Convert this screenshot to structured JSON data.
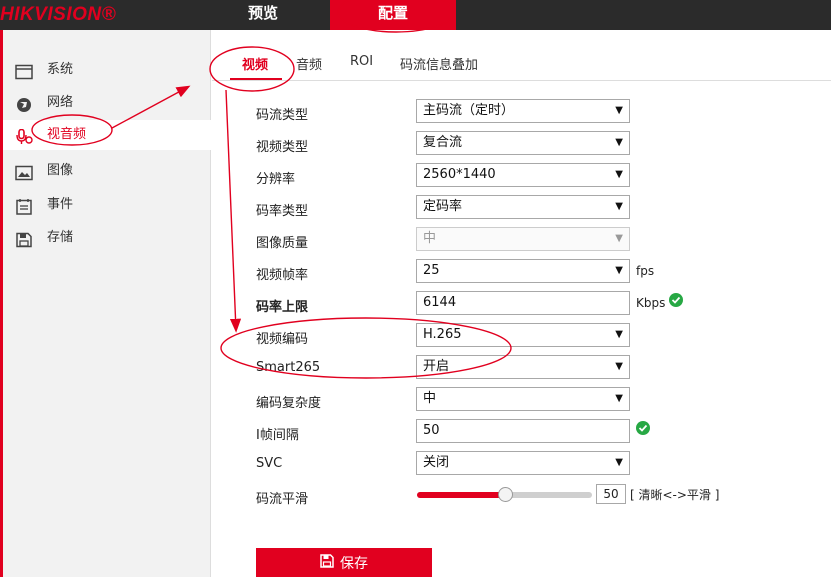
{
  "header": {
    "logo": "HIKVISION®",
    "tabs": [
      "预览",
      "配置"
    ],
    "active_tab": "配置"
  },
  "sidebar": {
    "items": [
      {
        "label": "系统",
        "icon": "system-icon"
      },
      {
        "label": "网络",
        "icon": "network-icon"
      },
      {
        "label": "视音频",
        "icon": "audio-video-icon"
      },
      {
        "label": "图像",
        "icon": "image-icon"
      },
      {
        "label": "事件",
        "icon": "event-icon"
      },
      {
        "label": "存储",
        "icon": "storage-icon"
      }
    ],
    "active_item": "视音频"
  },
  "subtabs": {
    "items": [
      "视频",
      "音频",
      "ROI",
      "码流信息叠加"
    ],
    "active": "视频"
  },
  "form": {
    "stream_type": {
      "label": "码流类型",
      "value": "主码流（定时）"
    },
    "video_type": {
      "label": "视频类型",
      "value": "复合流"
    },
    "resolution": {
      "label": "分辨率",
      "value": "2560*1440"
    },
    "bitrate_type": {
      "label": "码率类型",
      "value": "定码率"
    },
    "image_quality": {
      "label": "图像质量",
      "value": "中"
    },
    "frame_rate": {
      "label": "视频帧率",
      "value": "25",
      "unit": "fps"
    },
    "max_bitrate": {
      "label": "码率上限",
      "value": "6144",
      "unit": "Kbps"
    },
    "video_encoding": {
      "label": "视频编码",
      "value": "H.265"
    },
    "smart265": {
      "label": "Smart265",
      "value": "开启"
    },
    "encoding_complexity": {
      "label": "编码复杂度",
      "value": "中"
    },
    "i_frame_interval": {
      "label": "I帧间隔",
      "value": "50"
    },
    "svc": {
      "label": "SVC",
      "value": "关闭"
    },
    "stream_smoothing": {
      "label": "码流平滑",
      "value": "50",
      "level": 0.5,
      "hint": "[ 清晰<->平滑 ]"
    }
  },
  "save_button": {
    "label": "保存"
  },
  "colors": {
    "accent": "#e1001f",
    "ok": "#27a844",
    "topbar": "#2b2b2b"
  }
}
